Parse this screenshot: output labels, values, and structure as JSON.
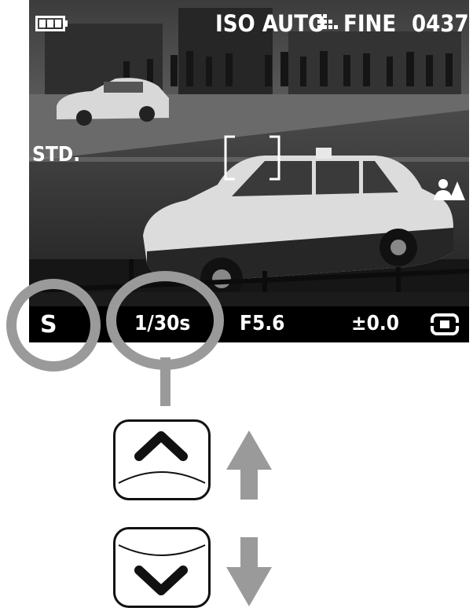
{
  "lcd": {
    "battery_icon": "battery-full-icon",
    "iso_label": "ISO AUTO",
    "quality_icon": "image-quality-grid-icon",
    "quality_label": "FINE",
    "shots_remaining": "0437",
    "image_tone_label": "STD.",
    "scene_mode_icon": "landscape-portrait-icon",
    "af_frame_icon": "af-frame-bracket-icon",
    "status_bar": {
      "mode": "S",
      "shutter_speed": "1/30s",
      "aperture": "F5.6",
      "exposure_compensation": "±0.0",
      "metering_icon": "multi-segment-metering-icon"
    }
  },
  "callouts": {
    "color": "#9a9a9a",
    "targets": [
      "mode",
      "shutter_speed"
    ]
  },
  "controls": {
    "up_key_icon": "chevron-up-icon",
    "down_key_icon": "chevron-down-icon",
    "increase_arrow_icon": "arrow-up-icon",
    "decrease_arrow_icon": "arrow-down-icon"
  }
}
